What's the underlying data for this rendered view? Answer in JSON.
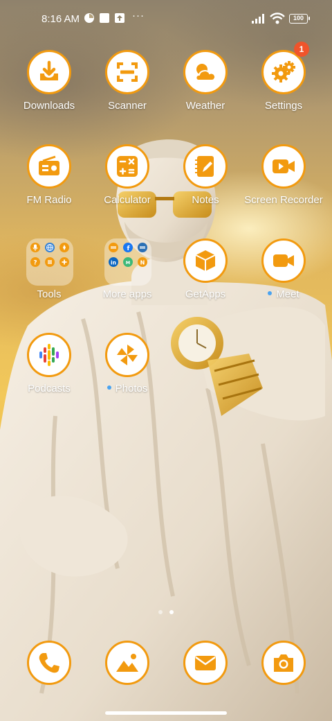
{
  "status_bar": {
    "time": "8:16 AM",
    "more": "···",
    "battery": "100",
    "icons": [
      "app-notification-icon",
      "square-notification-icon",
      "upload-notification-icon",
      "signal-icon",
      "wifi-icon",
      "battery-icon"
    ]
  },
  "apps": {
    "downloads": "Downloads",
    "scanner": "Scanner",
    "weather": "Weather",
    "settings": "Settings",
    "settings_badge": "1",
    "fm_radio": "FM Radio",
    "calculator": "Calculator",
    "notes": "Notes",
    "screen_recorder": "Screen Recorder",
    "tools": "Tools",
    "more_apps": "More apps",
    "getapps": "GetApps",
    "meet": "Meet",
    "podcasts": "Podcasts",
    "photos": "Photos"
  },
  "pages": {
    "count": 2,
    "current": 2
  },
  "dock": [
    "phone-icon",
    "gallery-icon",
    "mail-icon",
    "camera-icon"
  ],
  "colors": {
    "accent": "#f29a0f",
    "icon_bg": "#ffffff",
    "badge": "#f0542b",
    "new_dot": "#4aa3f0"
  }
}
